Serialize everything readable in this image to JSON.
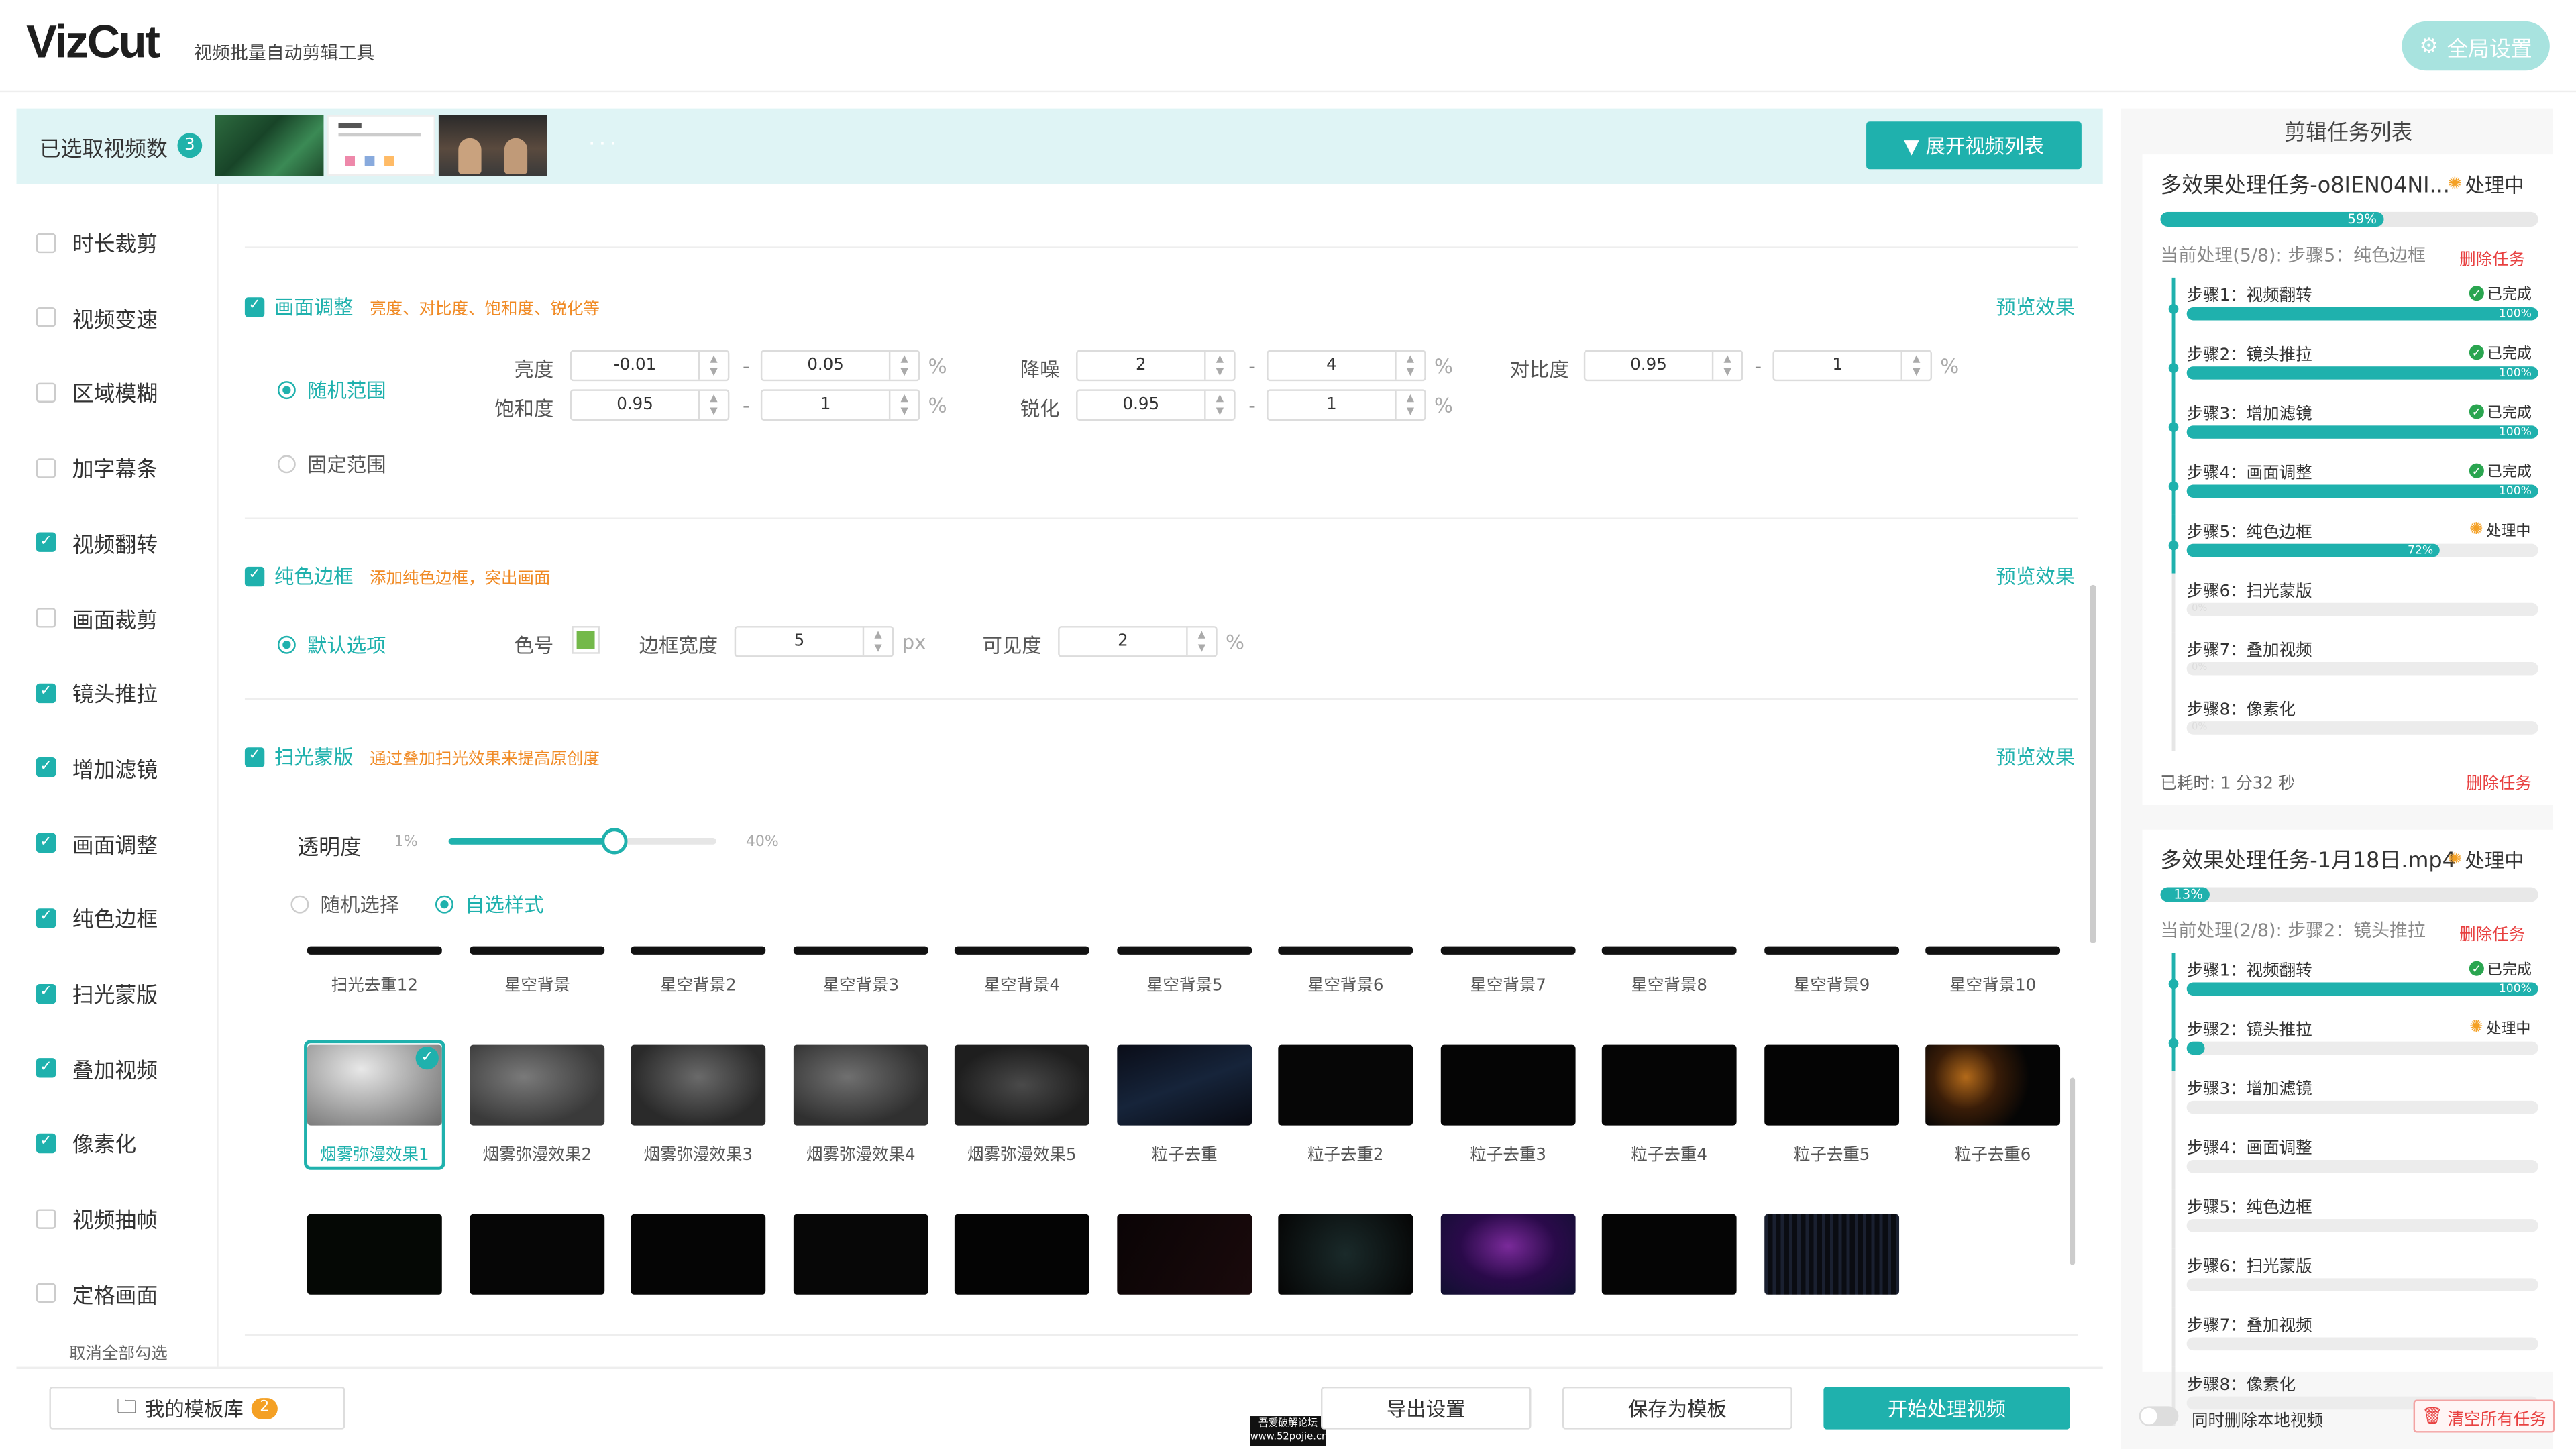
{
  "header": {
    "logo": "VizCut",
    "subtitle": "视频批量自动剪辑工具",
    "global_settings": "全局设置"
  },
  "banner": {
    "label": "已选取视频数",
    "count": "3",
    "more": "···",
    "expand": "展开视频列表"
  },
  "sidebar": {
    "items": [
      {
        "label": "时长裁剪",
        "checked": false
      },
      {
        "label": "视频变速",
        "checked": false
      },
      {
        "label": "区域模糊",
        "checked": false
      },
      {
        "label": "加字幕条",
        "checked": false
      },
      {
        "label": "视频翻转",
        "checked": true
      },
      {
        "label": "画面裁剪",
        "checked": false
      },
      {
        "label": "镜头推拉",
        "checked": true
      },
      {
        "label": "增加滤镜",
        "checked": true
      },
      {
        "label": "画面调整",
        "checked": true
      },
      {
        "label": "纯色边框",
        "checked": true
      },
      {
        "label": "扫光蒙版",
        "checked": true
      },
      {
        "label": "叠加视频",
        "checked": true
      },
      {
        "label": "像素化",
        "checked": true
      },
      {
        "label": "视频抽帧",
        "checked": false
      },
      {
        "label": "定格画面",
        "checked": false
      }
    ],
    "unselect_all": "取消全部勾选"
  },
  "adjust": {
    "title": "画面调整",
    "desc": "亮度、对比度、饱和度、锐化等",
    "preview": "预览效果",
    "random": "随机范围",
    "fixed": "固定范围",
    "brightness": {
      "label": "亮度",
      "min": "-0.01",
      "max": "0.05",
      "unit": "%"
    },
    "saturation": {
      "label": "饱和度",
      "min": "0.95",
      "max": "1",
      "unit": "%"
    },
    "denoise": {
      "label": "降噪",
      "min": "2",
      "max": "4",
      "unit": "%"
    },
    "sharpen": {
      "label": "锐化",
      "min": "0.95",
      "max": "1",
      "unit": "%"
    },
    "contrast": {
      "label": "对比度",
      "min": "0.95",
      "max": "1",
      "unit": "%"
    },
    "dash": "-"
  },
  "border": {
    "title": "纯色边框",
    "desc": "添加纯色边框，突出画面",
    "preview": "预览效果",
    "default": "默认选项",
    "color_label": "色号",
    "color": "#74b94a",
    "width_label": "边框宽度",
    "width": "5",
    "width_unit": "px",
    "vis_label": "可见度",
    "vis": "2",
    "vis_unit": "%"
  },
  "sweep": {
    "title": "扫光蒙版",
    "desc": "通过叠加扫光效果来提高原创度",
    "preview": "预览效果",
    "opacity_label": "透明度",
    "opacity_min": "1%",
    "opacity_max": "40%",
    "opacity_value": 0.62,
    "random": "随机选择",
    "custom": "自选样式",
    "row1": [
      "扫光去重12",
      "星空背景",
      "星空背景2",
      "星空背景3",
      "星空背景4",
      "星空背景5",
      "星空背景6",
      "星空背景7",
      "星空背景8",
      "星空背景9",
      "星空背景10"
    ],
    "row2": [
      "烟雾弥漫效果1",
      "烟雾弥漫效果2",
      "烟雾弥漫效果3",
      "烟雾弥漫效果4",
      "烟雾弥漫效果5",
      "粒子去重",
      "粒子去重2",
      "粒子去重3",
      "粒子去重4",
      "粒子去重5",
      "粒子去重6"
    ],
    "selected": "烟雾弥漫效果1"
  },
  "footer": {
    "templates": "我的模板库",
    "templates_count": "2",
    "export": "导出设置",
    "save_template": "保存为模板",
    "start": "开始处理视频",
    "watermark_line1": "吾爱破解论坛",
    "watermark_line2": "www.52pojie.cn"
  },
  "tasks": {
    "title": "剪辑任务列表",
    "delete_local": "同时删除本地视频",
    "clear_all": "清空所有任务",
    "list": [
      {
        "name": "多效果处理任务-o8IEN04NI...",
        "status": "处理中",
        "progress": 59,
        "progress_label": "59%",
        "current": "当前处理(5/8): 步骤5：纯色边框",
        "delete": "删除任务",
        "elapsed": "已耗时: 1 分32 秒",
        "steps": [
          {
            "label": "步骤1：视频翻转",
            "status": "已完成",
            "progress": 100,
            "plabel": "100%"
          },
          {
            "label": "步骤2：镜头推拉",
            "status": "已完成",
            "progress": 100,
            "plabel": "100%"
          },
          {
            "label": "步骤3：增加滤镜",
            "status": "已完成",
            "progress": 100,
            "plabel": "100%"
          },
          {
            "label": "步骤4：画面调整",
            "status": "已完成",
            "progress": 100,
            "plabel": "100%"
          },
          {
            "label": "步骤5：纯色边框",
            "status": "处理中",
            "progress": 72,
            "plabel": "72%"
          },
          {
            "label": "步骤6：扫光蒙版",
            "status": "",
            "progress": 0,
            "plabel": "0%"
          },
          {
            "label": "步骤7：叠加视频",
            "status": "",
            "progress": 0,
            "plabel": "0%"
          },
          {
            "label": "步骤8：像素化",
            "status": "",
            "progress": 0,
            "plabel": "0%"
          }
        ]
      },
      {
        "name": "多效果处理任务-1月18日.mp4",
        "status": "处理中",
        "progress": 13,
        "progress_label": "13%",
        "current": "当前处理(2/8): 步骤2：镜头推拉",
        "delete": "删除任务",
        "steps": [
          {
            "label": "步骤1：视频翻转",
            "status": "已完成",
            "progress": 100,
            "plabel": "100%"
          },
          {
            "label": "步骤2：镜头推拉",
            "status": "处理中",
            "progress": 5,
            "plabel": ""
          },
          {
            "label": "步骤3：增加滤镜",
            "status": "",
            "progress": 0,
            "plabel": ""
          },
          {
            "label": "步骤4：画面调整",
            "status": "",
            "progress": 0,
            "plabel": ""
          },
          {
            "label": "步骤5：纯色边框",
            "status": "",
            "progress": 0,
            "plabel": ""
          },
          {
            "label": "步骤6：扫光蒙版",
            "status": "",
            "progress": 0,
            "plabel": ""
          },
          {
            "label": "步骤7：叠加视频",
            "status": "",
            "progress": 0,
            "plabel": ""
          },
          {
            "label": "步骤8：像素化",
            "status": "",
            "progress": 0,
            "plabel": ""
          }
        ]
      }
    ]
  }
}
